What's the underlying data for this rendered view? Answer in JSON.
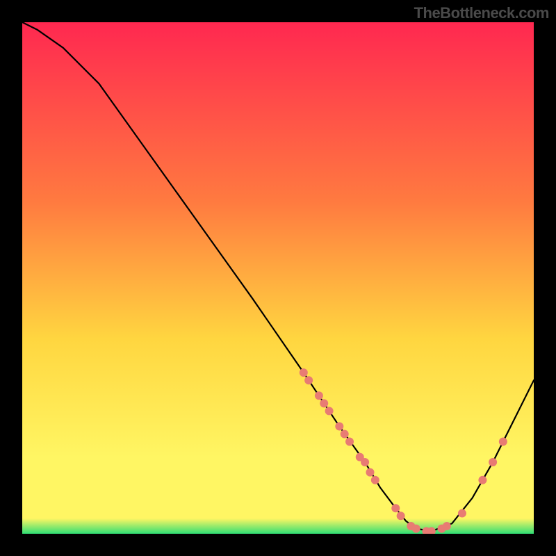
{
  "watermark": "TheBottleneck.com",
  "chart_data": {
    "type": "line",
    "title": "",
    "xlabel": "",
    "ylabel": "",
    "xlim": [
      0,
      100
    ],
    "ylim": [
      0,
      100
    ],
    "gradient_colors": {
      "top": "#ff2850",
      "mid_upper": "#ff7a40",
      "mid": "#ffd640",
      "mid_lower": "#fff663",
      "bottom": "#2fde74"
    },
    "series": [
      {
        "name": "bottleneck-curve",
        "color": "#000000",
        "x": [
          0,
          3,
          8,
          15,
          25,
          35,
          45,
          55,
          62,
          67,
          70,
          73,
          75,
          77,
          80,
          84,
          88,
          92,
          96,
          100
        ],
        "y": [
          100,
          98.5,
          95,
          88,
          74,
          60,
          46,
          31.5,
          21,
          14,
          9,
          5,
          2.5,
          1,
          0.5,
          2,
          7,
          14,
          22,
          30
        ]
      }
    ],
    "markers": {
      "name": "highlighted-points",
      "color": "#e87b73",
      "radius": 6,
      "points": [
        {
          "x": 55,
          "y": 31.5
        },
        {
          "x": 56,
          "y": 30
        },
        {
          "x": 58,
          "y": 27
        },
        {
          "x": 59,
          "y": 25.5
        },
        {
          "x": 60,
          "y": 24
        },
        {
          "x": 62,
          "y": 21
        },
        {
          "x": 63,
          "y": 19.5
        },
        {
          "x": 64,
          "y": 18
        },
        {
          "x": 66,
          "y": 15
        },
        {
          "x": 67,
          "y": 14
        },
        {
          "x": 68,
          "y": 12
        },
        {
          "x": 69,
          "y": 10.5
        },
        {
          "x": 73,
          "y": 5
        },
        {
          "x": 74,
          "y": 3.5
        },
        {
          "x": 76,
          "y": 1.5
        },
        {
          "x": 77,
          "y": 1
        },
        {
          "x": 79,
          "y": 0.5
        },
        {
          "x": 80,
          "y": 0.5
        },
        {
          "x": 82,
          "y": 1
        },
        {
          "x": 83,
          "y": 1.5
        },
        {
          "x": 86,
          "y": 4
        },
        {
          "x": 90,
          "y": 10.5
        },
        {
          "x": 92,
          "y": 14
        },
        {
          "x": 94,
          "y": 18
        }
      ]
    }
  }
}
